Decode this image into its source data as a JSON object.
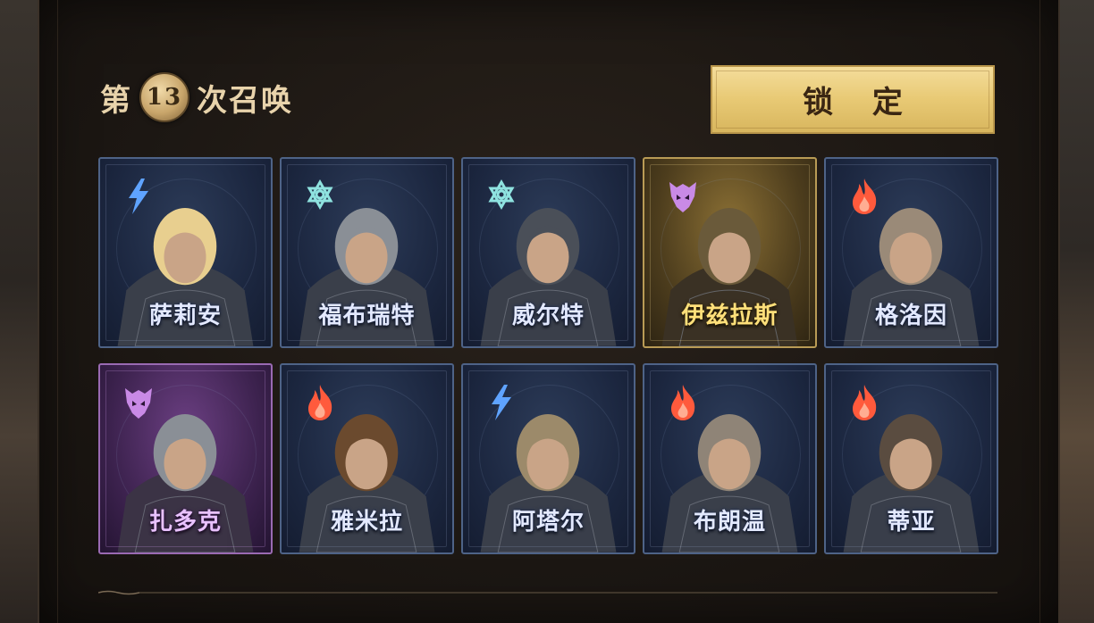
{
  "summon": {
    "prefix": "第",
    "round": "13",
    "suffix": "次召唤"
  },
  "lock_button": {
    "label": "锁 定"
  },
  "colors": {
    "lightning": "#5fa3ff",
    "frost": "#8fe3e0",
    "dark": "#c98ae6",
    "fire": "#ff5a3c",
    "gold_button": "#e8c974"
  },
  "heroes": [
    {
      "name": "萨莉安",
      "element": "lightning-icon",
      "rarity": "blue"
    },
    {
      "name": "福布瑞特",
      "element": "frost-icon",
      "rarity": "blue"
    },
    {
      "name": "威尔特",
      "element": "frost-icon",
      "rarity": "blue"
    },
    {
      "name": "伊兹拉斯",
      "element": "dark-icon",
      "rarity": "gold"
    },
    {
      "name": "格洛因",
      "element": "fire-icon",
      "rarity": "blue"
    },
    {
      "name": "扎多克",
      "element": "dark-icon",
      "rarity": "purple"
    },
    {
      "name": "雅米拉",
      "element": "fire-icon",
      "rarity": "blue"
    },
    {
      "name": "阿塔尔",
      "element": "lightning-icon",
      "rarity": "blue"
    },
    {
      "name": "布朗温",
      "element": "fire-icon",
      "rarity": "blue"
    },
    {
      "name": "蒂亚",
      "element": "fire-icon",
      "rarity": "blue"
    }
  ]
}
